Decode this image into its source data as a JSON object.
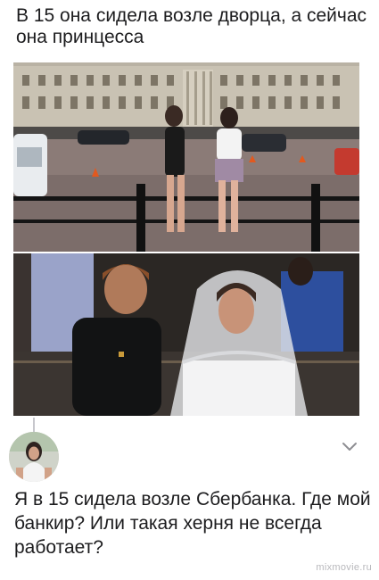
{
  "post": {
    "caption": "В 15 она сидела возле дворца, а сейчас она принцесса"
  },
  "photos": {
    "palace_icon": "photo-palace",
    "wedding_icon": "photo-wedding"
  },
  "reply": {
    "avatar_icon": "user-avatar",
    "expand_icon": "chevron-down-icon",
    "text": "Я в 15 сидела возле Сбербанка. Где мой банкир? Или такая херня не всегда работает?"
  },
  "watermark": "mixmovie.ru",
  "colors": {
    "text": "#1c1c1e",
    "chevron": "#8e8e93",
    "thread_line": "#c7c7cc",
    "watermark": "#b8b8bc"
  }
}
